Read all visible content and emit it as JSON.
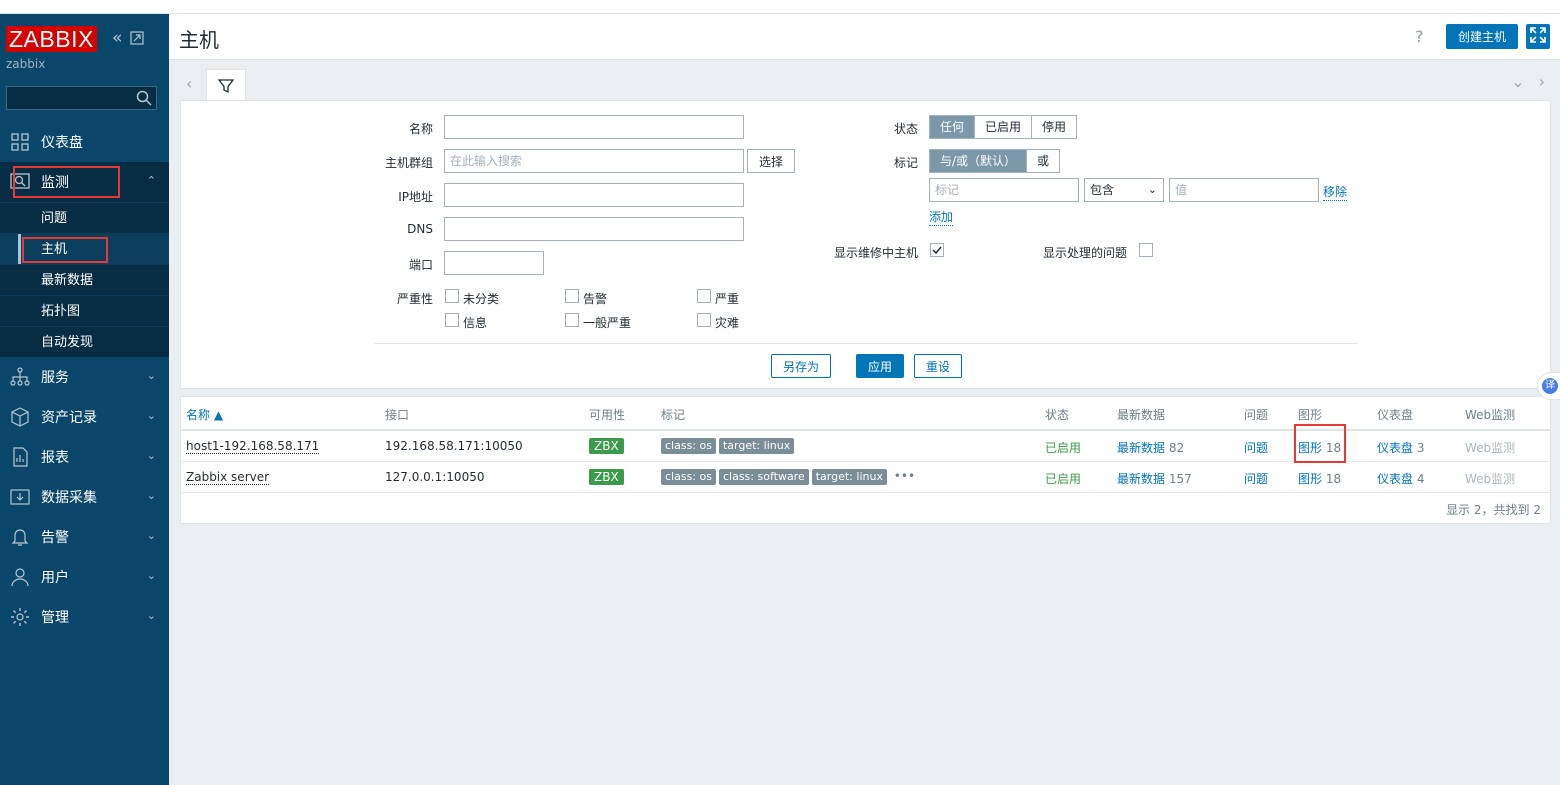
{
  "brand": {
    "logo": "ZABBIX",
    "server": "zabbix"
  },
  "sidebar": {
    "search_placeholder": "",
    "items": [
      {
        "label": "仪表盘"
      },
      {
        "label": "监测"
      },
      {
        "label": "服务"
      },
      {
        "label": "资产记录"
      },
      {
        "label": "报表"
      },
      {
        "label": "数据采集"
      },
      {
        "label": "告警"
      },
      {
        "label": "用户"
      },
      {
        "label": "管理"
      }
    ],
    "monitoring_sub": [
      {
        "label": "问题"
      },
      {
        "label": "主机"
      },
      {
        "label": "最新数据"
      },
      {
        "label": "拓扑图"
      },
      {
        "label": "自动发现"
      }
    ]
  },
  "header": {
    "title": "主机",
    "help": "?",
    "create_host": "创建主机"
  },
  "filter": {
    "name_label": "名称",
    "hostgroup_label": "主机群组",
    "hostgroup_placeholder": "在此输入搜索",
    "select_btn": "选择",
    "ip_label": "IP地址",
    "dns_label": "DNS",
    "port_label": "端口",
    "severity_label": "严重性",
    "severities": [
      "未分类",
      "告警",
      "严重",
      "信息",
      "一般严重",
      "灾难"
    ],
    "status_label": "状态",
    "status_options": [
      "任何",
      "已启用",
      "停用"
    ],
    "tags_label": "标记",
    "tags_options": [
      "与/或（默认）",
      "或"
    ],
    "tag_placeholder": "标记",
    "tag_operator": "包含",
    "value_placeholder": "值",
    "remove": "移除",
    "add": "添加",
    "show_maintenance": "显示维修中主机",
    "show_suppressed": "显示处理的问题",
    "save_as": "另存为",
    "apply": "应用",
    "reset": "重设"
  },
  "table": {
    "columns": [
      "名称 ▲",
      "接口",
      "可用性",
      "标记",
      "状态",
      "最新数据",
      "问题",
      "图形",
      "仪表盘",
      "Web监测"
    ],
    "rows": [
      {
        "name": "host1-192.168.58.171",
        "interface": "192.168.58.171:10050",
        "availability": "ZBX",
        "tags": [
          "class: os",
          "target: linux"
        ],
        "status": "已启用",
        "latest_label": "最新数据",
        "latest_count": "82",
        "problems": "问题",
        "graphs_label": "图形",
        "graphs_count": "18",
        "dash_label": "仪表盘",
        "dash_count": "3",
        "web": "Web监测"
      },
      {
        "name": "Zabbix server",
        "interface": "127.0.0.1:10050",
        "availability": "ZBX",
        "tags": [
          "class: os",
          "class: software",
          "target: linux"
        ],
        "more": "•••",
        "status": "已启用",
        "latest_label": "最新数据",
        "latest_count": "157",
        "problems": "问题",
        "graphs_label": "图形",
        "graphs_count": "18",
        "dash_label": "仪表盘",
        "dash_count": "4",
        "web": "Web监测"
      }
    ],
    "footer": "显示 2，共找到 2"
  },
  "translate": "译",
  "colors": {
    "sidebar": "#0a466a",
    "accent": "#0275b8",
    "highlight": "#e53935"
  }
}
